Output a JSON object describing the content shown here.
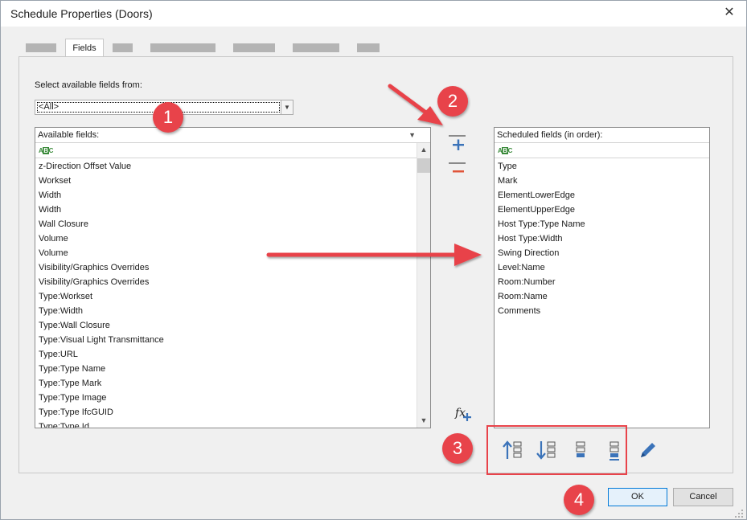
{
  "window": {
    "title": "Schedule Properties (Doors)",
    "close_glyph": "✕"
  },
  "tabs": {
    "active_label": "Fields"
  },
  "selector": {
    "label": "Select available fields from:",
    "value": "<All>"
  },
  "available": {
    "header": "Available fields:",
    "items": [
      "z-Direction Offset Value",
      "Workset",
      "Width",
      "Width",
      "Wall Closure",
      "Volume",
      "Volume",
      "Visibility/Graphics Overrides",
      "Visibility/Graphics Overrides",
      "Type:Workset",
      "Type:Width",
      "Type:Wall Closure",
      "Type:Visual Light Transmittance",
      "Type:URL",
      "Type:Type Name",
      "Type:Type Mark",
      "Type:Type Image",
      "Type:Type IfcGUID",
      "Type:Type Id"
    ]
  },
  "scheduled": {
    "header": "Scheduled fields (in order):",
    "items": [
      "Type",
      "Mark",
      "ElementLowerEdge",
      "ElementUpperEdge",
      "Host Type:Type Name",
      "Host Type:Width",
      "Swing Direction",
      "Level:Name",
      "Room:Number",
      "Room:Name",
      "Comments"
    ]
  },
  "annotations": {
    "badge1": "1",
    "badge2": "2",
    "badge3": "3",
    "badge4": "4",
    "color": "#e8434a"
  },
  "buttons": {
    "ok": "OK",
    "cancel": "Cancel"
  },
  "icons": {
    "add": "add-parameter-icon",
    "remove": "remove-parameter-icon",
    "formula": "fx-add-icon",
    "move_up": "move-up-icon",
    "move_down": "move-down-icon",
    "insert_before": "insert-before-icon",
    "insert_after": "insert-after-icon",
    "edit": "pencil-icon",
    "accent": "#3b73b9",
    "remove_accent": "#e0553a"
  }
}
